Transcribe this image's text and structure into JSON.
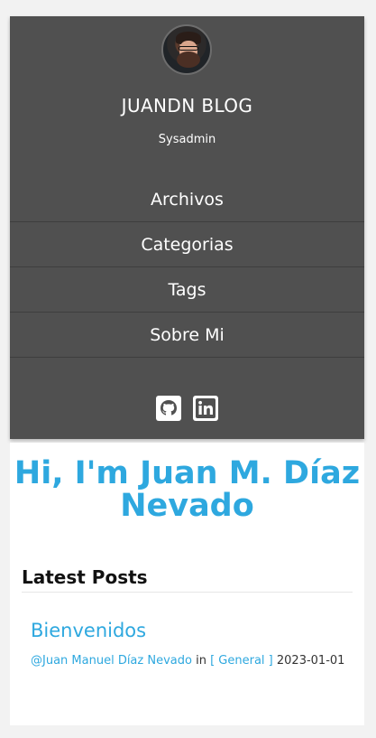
{
  "sidebar": {
    "title": "JUANDN BLOG",
    "subtitle": "Sysadmin",
    "nav": [
      "Archivos",
      "Categorias",
      "Tags",
      "Sobre Mi"
    ],
    "social_icons": [
      "github-icon",
      "linkedin-icon"
    ]
  },
  "main": {
    "hero": "Hi, I'm Juan M. Díaz Nevado",
    "latest_heading": "Latest Posts",
    "post": {
      "title": "Bienvenidos",
      "author": "@Juan Manuel Díaz Nevado",
      "in_label": "in",
      "category": "[ General ]",
      "date": "2023-01-01"
    }
  },
  "colors": {
    "sidebar_bg": "#505050",
    "accent": "#2ea8df",
    "page_bg": "#f2f2f2"
  }
}
